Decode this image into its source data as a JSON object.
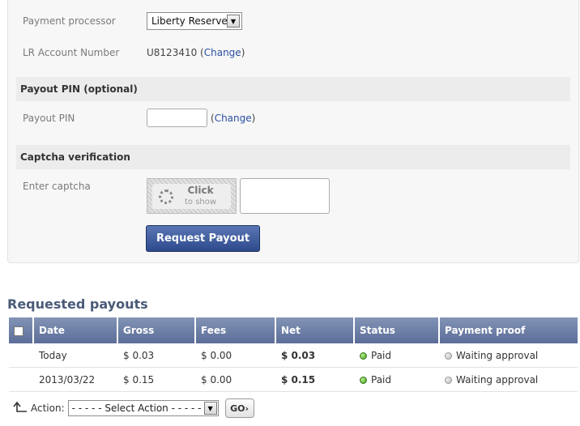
{
  "payout_form": {
    "processor_label": "Payment processor",
    "processor_value": "Liberty Reserve",
    "account_label": "LR Account Number",
    "account_value": "U8123410",
    "change_link": "Change",
    "pin_section": "Payout PIN (optional)",
    "pin_label": "Payout PIN",
    "pin_change_link": "Change",
    "captcha_section": "Captcha verification",
    "captcha_label": "Enter captcha",
    "captcha_click": "Click",
    "captcha_sub": "to show",
    "submit_label": "Request Payout"
  },
  "requested": {
    "title": "Requested payouts",
    "columns": [
      "Date",
      "Gross",
      "Fees",
      "Net",
      "Status",
      "Payment proof"
    ],
    "rows": [
      {
        "date": "Today",
        "gross": "$ 0.03",
        "fees": "$ 0.00",
        "net": "$ 0.03",
        "status": "Paid",
        "proof": "Waiting approval"
      },
      {
        "date": "2013/03/22",
        "gross": "$ 0.15",
        "fees": "$ 0.00",
        "net": "$ 0.15",
        "status": "Paid",
        "proof": "Waiting approval"
      }
    ]
  },
  "actions": {
    "label": "Action:",
    "select_value": "- - - - - Select Action - - - - -",
    "go_label": "GO›"
  },
  "colors": {
    "accent": "#2d4a8c",
    "status_paid": "#3f9a1f",
    "status_waiting": "#b8b8b8"
  }
}
